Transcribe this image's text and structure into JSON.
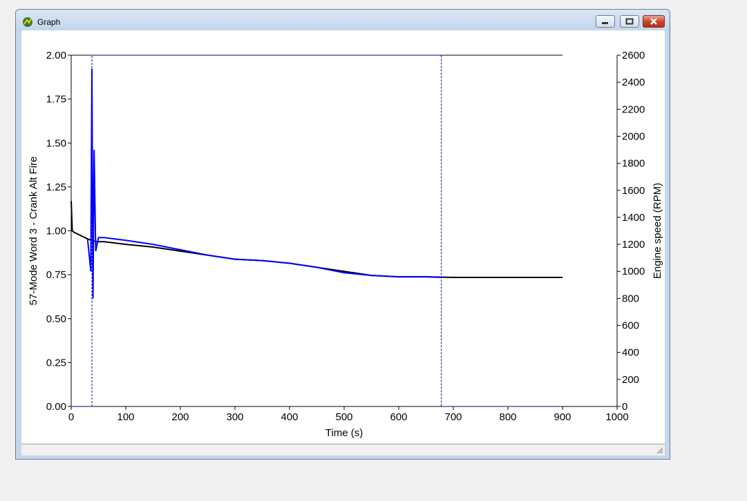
{
  "window": {
    "title": "Graph",
    "icon": "app-graph-icon"
  },
  "chart_data": {
    "type": "line",
    "xlabel": "Time (s)",
    "ylabel_left": "57-Mode Word 3 - Crank Alt Fire",
    "ylabel_right": "Engine speed (RPM)",
    "xlim": [
      0,
      1000
    ],
    "ylim_left": [
      0,
      2.0
    ],
    "ylim_right": [
      0,
      2600
    ],
    "x_ticks": [
      0,
      100,
      200,
      300,
      400,
      500,
      600,
      700,
      800,
      900,
      1000
    ],
    "y_left_ticks": [
      "0.00",
      "0.25",
      "0.50",
      "0.75",
      "1.00",
      "1.25",
      "1.50",
      "1.75",
      "2.00"
    ],
    "y_right_ticks": [
      0,
      200,
      400,
      600,
      800,
      1000,
      1200,
      1400,
      1600,
      1800,
      2000,
      2200,
      2400,
      2600
    ],
    "grid": false,
    "series": [
      {
        "axis": "left",
        "color": "#000000",
        "step": true,
        "x": [
          0,
          900
        ],
        "values": [
          2.0,
          2.0
        ]
      },
      {
        "axis": "left",
        "color": "#0000cc",
        "step": true,
        "dashed": true,
        "x": [
          0,
          38,
          38,
          678,
          678,
          900
        ],
        "values": [
          0,
          0,
          2.0,
          2.0,
          0,
          0
        ]
      },
      {
        "axis": "right",
        "color": "#000000",
        "x": [
          0,
          2,
          5,
          15,
          30,
          45,
          60,
          80,
          100,
          150,
          200,
          250,
          300,
          350,
          400,
          450,
          500,
          550,
          600,
          650,
          700,
          750,
          800,
          850,
          900
        ],
        "values": [
          1520,
          1300,
          1290,
          1270,
          1240,
          1220,
          1220,
          1210,
          1200,
          1180,
          1150,
          1120,
          1090,
          1080,
          1060,
          1030,
          1000,
          970,
          960,
          960,
          955,
          955,
          955,
          955,
          955
        ]
      },
      {
        "axis": "right",
        "color": "#0000ff",
        "x": [
          30,
          36,
          38,
          40,
          42,
          45,
          50,
          60,
          80,
          100,
          150,
          200,
          250,
          300,
          350,
          400,
          450,
          500,
          550,
          600,
          650,
          680
        ],
        "values": [
          1240,
          1000,
          2500,
          800,
          1900,
          1150,
          1250,
          1250,
          1240,
          1230,
          1200,
          1160,
          1120,
          1090,
          1080,
          1060,
          1030,
          990,
          970,
          960,
          960,
          955
        ]
      }
    ]
  }
}
